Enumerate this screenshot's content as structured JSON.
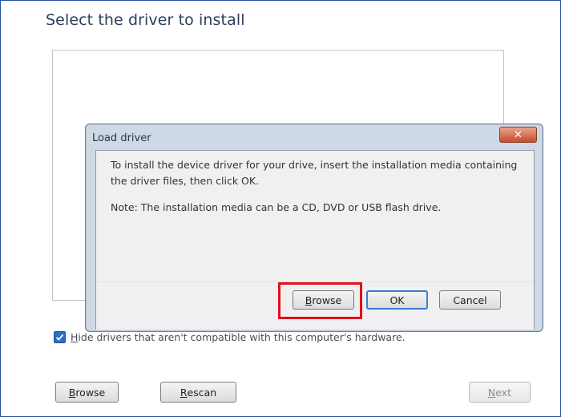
{
  "page": {
    "title": "Select the driver to install",
    "hide_drivers_checked": true,
    "hide_drivers_label_first": "H",
    "hide_drivers_label_rest": "ide drivers that aren't compatible with this computer's hardware.",
    "buttons": {
      "browse_u": "B",
      "browse_rest": "rowse",
      "rescan_u": "R",
      "rescan_rest": "escan",
      "next_u": "N",
      "next_rest": "ext"
    }
  },
  "dialog": {
    "title": "Load driver",
    "close_symbol": "✕",
    "message": "To install the device driver for your drive, insert the installation media containing the driver files, then click OK.",
    "note": "Note: The installation media can be a CD, DVD or USB flash drive.",
    "buttons": {
      "browse_u": "B",
      "browse_rest": "rowse",
      "ok": "OK",
      "cancel": "Cancel"
    }
  },
  "annotation": {
    "highlight_color": "#e0101a"
  }
}
